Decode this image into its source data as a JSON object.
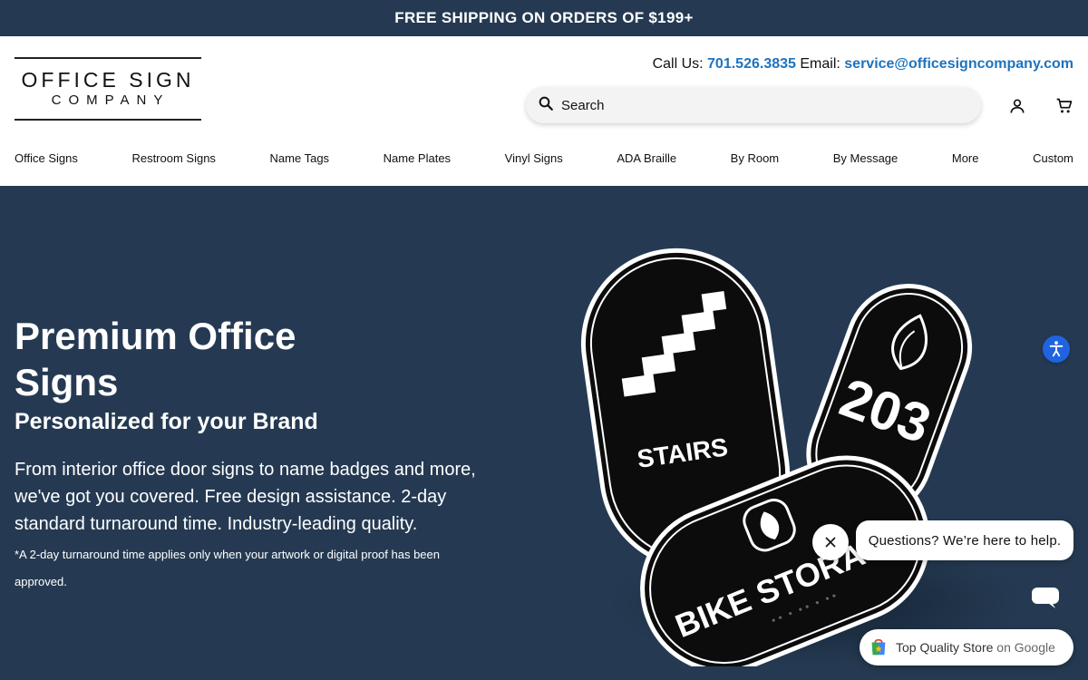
{
  "topbar": {
    "text": "FREE SHIPPING ON ORDERS OF $199+"
  },
  "logo": {
    "line1": "OFFICE SIGN",
    "line2": "COMPANY"
  },
  "contact": {
    "call_label": "Call Us:",
    "phone": "701.526.3835",
    "email_label": "Email:",
    "email": "service@officesigncompany.com"
  },
  "search": {
    "placeholder": "Search",
    "icon": "search-icon"
  },
  "header_icons": [
    "account-icon",
    "cart-icon"
  ],
  "nav": {
    "items": [
      "Office Signs",
      "Restroom Signs",
      "Name Tags",
      "Name Plates",
      "Vinyl Signs",
      "ADA Braille",
      "By Room",
      "By Message",
      "More",
      "Custom"
    ]
  },
  "hero": {
    "title": "Premium Office Signs",
    "subtitle": "Personalized for your Brand",
    "description": "From interior office door signs to name badges and more, we've got you covered. Free design assistance. 2-day standard turnaround time. Industry-leading quality.",
    "note": "*A 2-day turnaround time applies only when your artwork or digital proof has been approved."
  },
  "signs": {
    "stairs_label": "STAIRS",
    "room_number": "203",
    "bike_label": "BIKE STORAGE"
  },
  "chat": {
    "message": "Questions? We’re here to help."
  },
  "google_badge": {
    "text": "Top Quality Store",
    "suffix": "on Google"
  },
  "colors": {
    "navy": "#253a52",
    "link": "#1e73be",
    "accessibility": "#1f63e0"
  }
}
